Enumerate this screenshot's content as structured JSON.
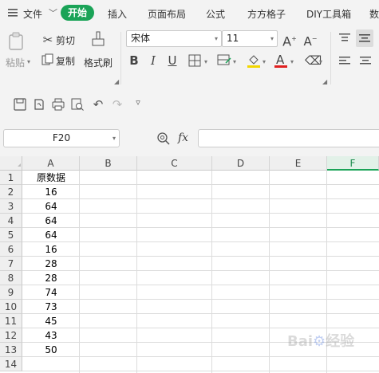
{
  "menu": {
    "file": "文件",
    "start": "开始",
    "items": [
      "插入",
      "页面布局",
      "公式",
      "方方格子",
      "DIY工具箱",
      "数"
    ]
  },
  "ribbon": {
    "paste": "粘贴",
    "cut": "剪切",
    "copy": "复制",
    "format_painter": "格式刷",
    "font_name": "宋体",
    "font_size": "11"
  },
  "namebox": "F20",
  "formula_label": "fx",
  "columns": [
    "A",
    "B",
    "C",
    "D",
    "E",
    "F"
  ],
  "selected_column": "F",
  "rows": [
    "1",
    "2",
    "3",
    "4",
    "5",
    "6",
    "7",
    "8",
    "9",
    "10",
    "11",
    "12",
    "13",
    "14"
  ],
  "column_a": [
    "原数据",
    "16",
    "64",
    "64",
    "64",
    "16",
    "28",
    "28",
    "74",
    "73",
    "45",
    "43",
    "50",
    ""
  ],
  "colors": {
    "accent": "#1aa357",
    "font_color_bar": "#e02020",
    "fill_color_bar": "#f2d600"
  }
}
